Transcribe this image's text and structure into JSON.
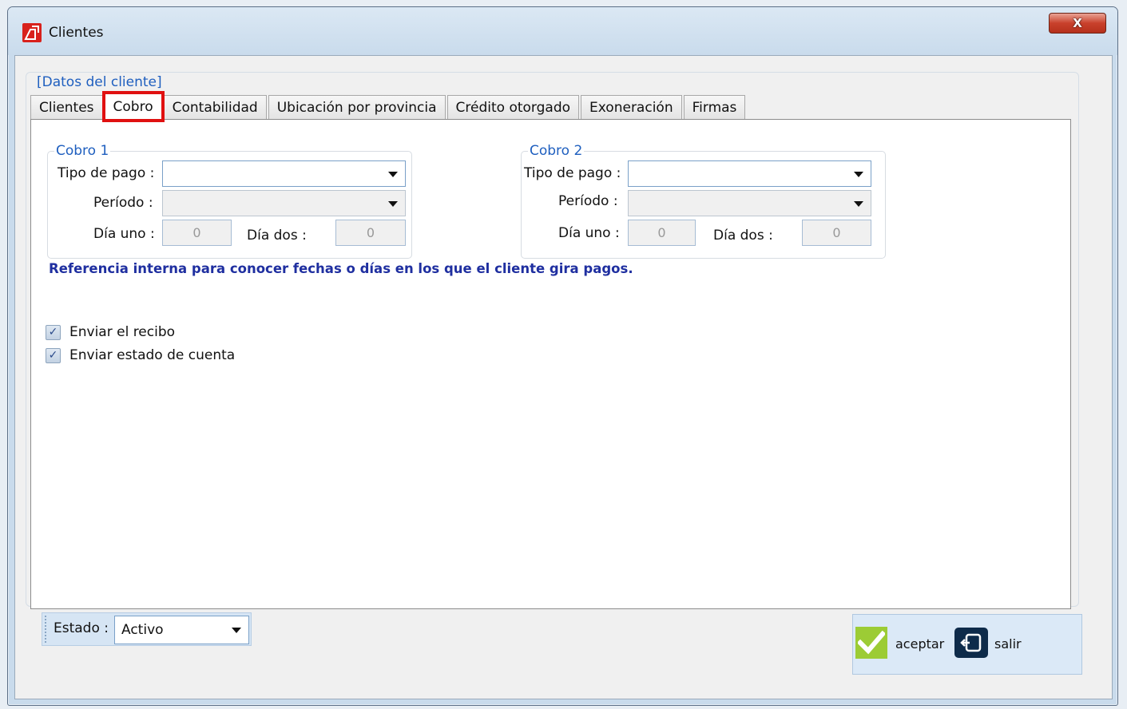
{
  "window": {
    "title": "Clientes",
    "close_label": "X"
  },
  "group": {
    "title": "[Datos del cliente]"
  },
  "tabs": [
    {
      "label": "Clientes"
    },
    {
      "label": "Cobro",
      "active": true
    },
    {
      "label": "Contabilidad"
    },
    {
      "label": "Ubicación por provincia"
    },
    {
      "label": "Crédito otorgado"
    },
    {
      "label": "Exoneración"
    },
    {
      "label": "Firmas"
    }
  ],
  "cobro1": {
    "title": "Cobro 1",
    "tipo_pago_label": "Tipo de pago :",
    "tipo_pago_value": "",
    "periodo_label": "Período :",
    "periodo_value": "",
    "dia_uno_label": "Día uno :",
    "dia_uno_value": "0",
    "dia_dos_label": "Día  dos :",
    "dia_dos_value": "0"
  },
  "cobro2": {
    "title": "Cobro 2",
    "tipo_pago_label": "Tipo de pago :",
    "tipo_pago_value": "",
    "periodo_label": "Período :",
    "periodo_value": "",
    "dia_uno_label": "Día uno :",
    "dia_uno_value": "0",
    "dia_dos_label": "Día dos :",
    "dia_dos_value": "0"
  },
  "note": "Referencia interna para conocer fechas o días en los que el cliente gira pagos.",
  "checkboxes": {
    "enviar_recibo": {
      "label": "Enviar el recibo",
      "checked": true
    },
    "enviar_estado": {
      "label": "Enviar estado de cuenta",
      "checked": true
    }
  },
  "estado": {
    "label": "Estado :",
    "value": "Activo"
  },
  "actions": {
    "aceptar_label": "aceptar",
    "salir_label": "salir"
  },
  "colors": {
    "accent_blue": "#1f5fbf",
    "note_blue": "#1f2fa0",
    "highlight_red": "#e01010",
    "ok_green": "#9ccc35"
  }
}
